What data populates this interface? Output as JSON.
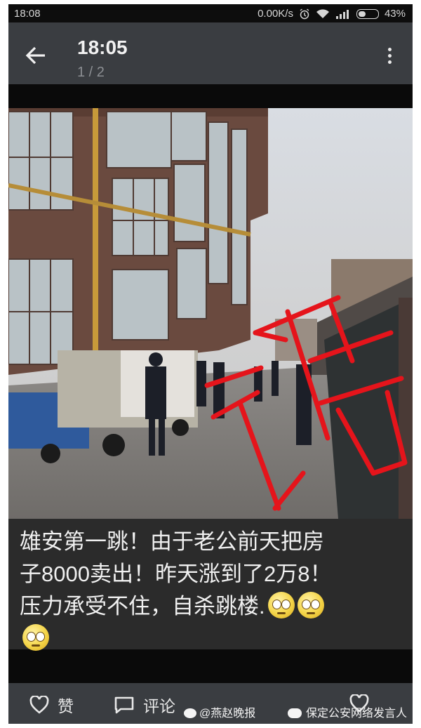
{
  "status_bar": {
    "time": "18:08",
    "network_speed": "0.00K/s",
    "battery": "43%",
    "icons": [
      "alarm-icon",
      "wifi-icon",
      "signal-icon",
      "battery-icon"
    ]
  },
  "app_bar": {
    "title": "18:05",
    "subtitle": "1 / 2",
    "back_icon": "arrow-left-icon",
    "more_icon": "more-vertical-icon"
  },
  "photo": {
    "stamp_text": "谣",
    "stamp_color": "#e5141b"
  },
  "caption": {
    "line1": "雄安第一跳！由于老公前天把房",
    "line2": "子8000卖出！昨天涨到了2万8！",
    "line3": "压力承受不住，自杀跳楼.",
    "emoji": "worried-face-emoji"
  },
  "action_bar": {
    "like_label": "赞",
    "comment_label": "评论"
  },
  "watermarks": {
    "left": "@燕赵晚报",
    "right": "保定公安网络发言人"
  },
  "colors": {
    "app_bar_bg": "#3a3d41",
    "caption_bg": "#2b2b2b",
    "stamp_red": "#e5141b"
  }
}
